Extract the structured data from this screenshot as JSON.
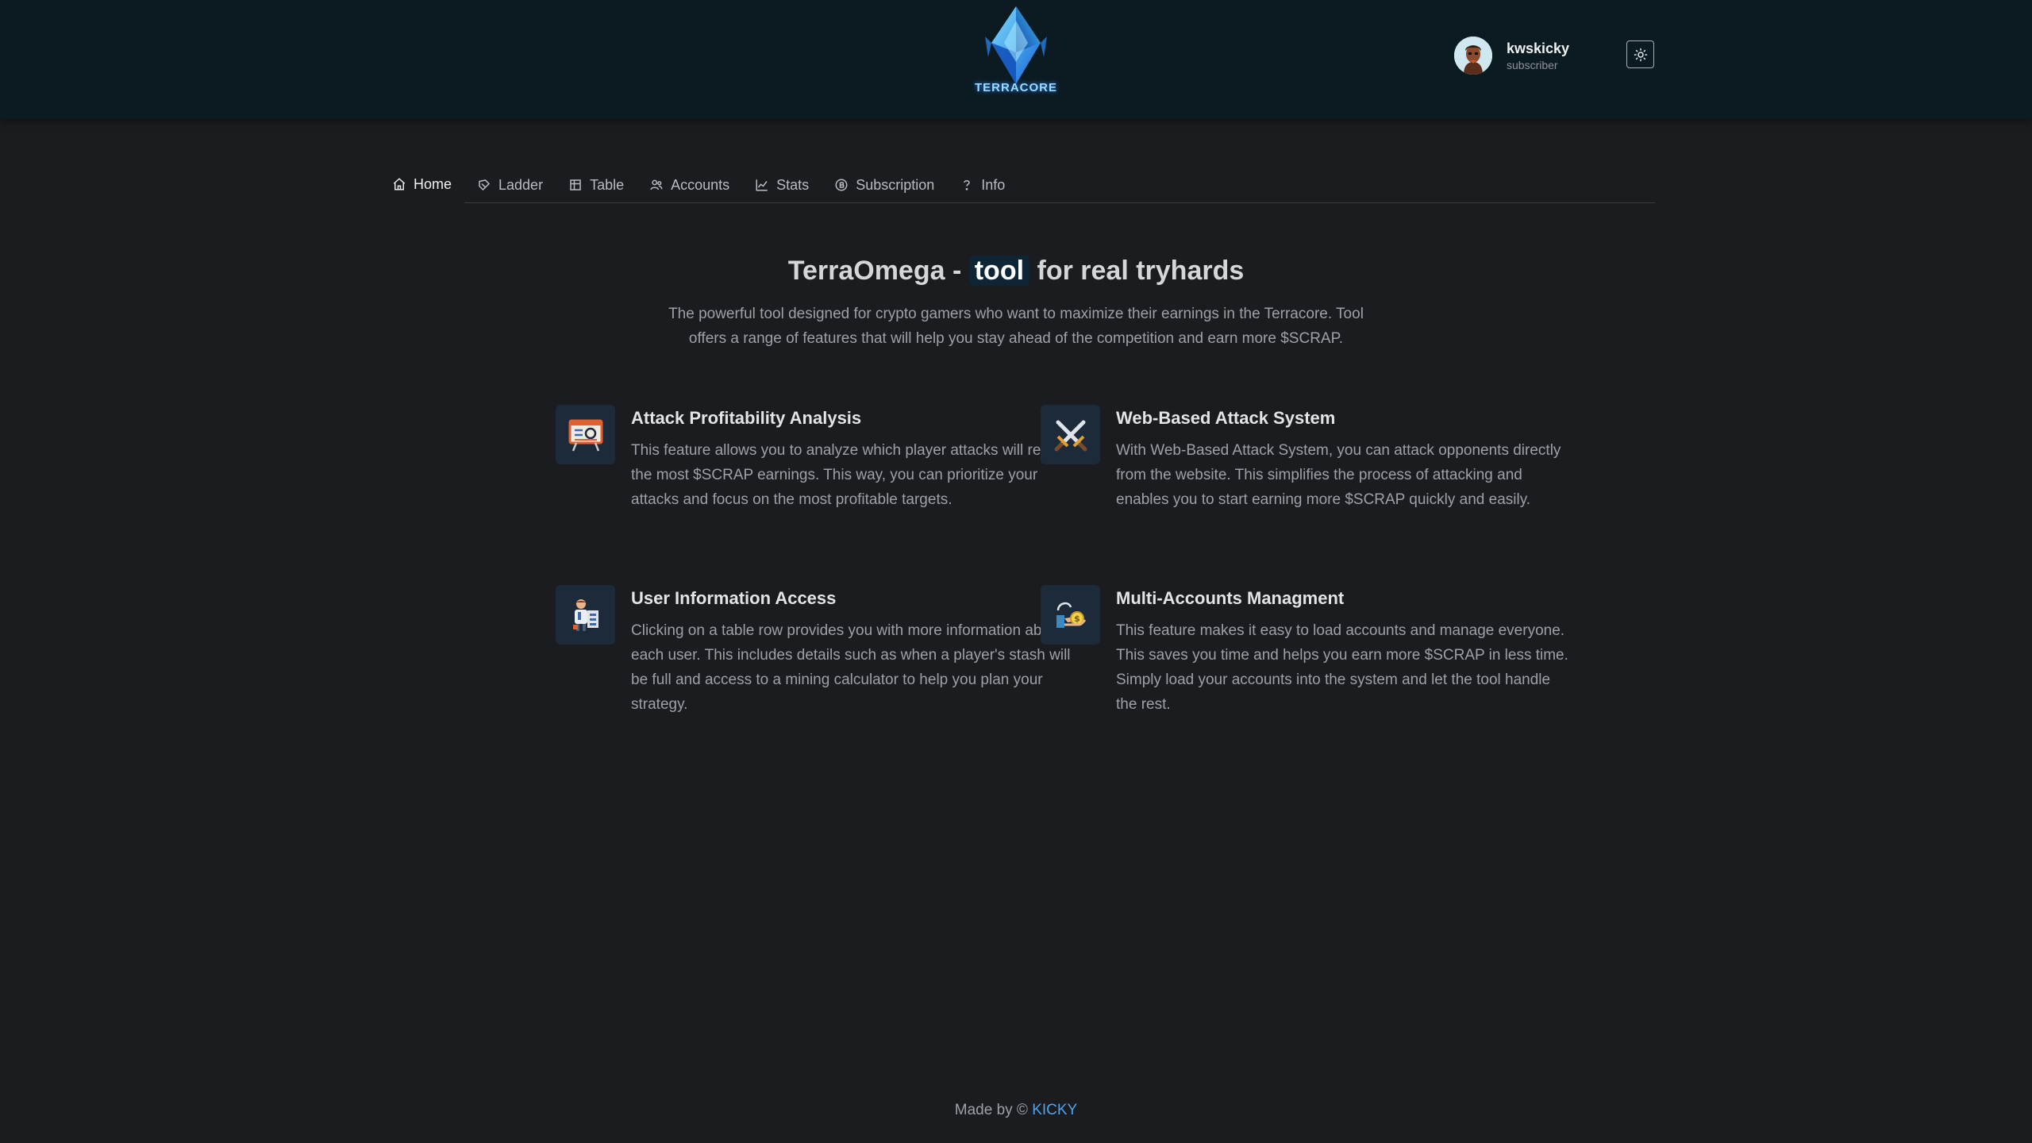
{
  "header": {
    "logo_text": "TERRACORE",
    "user": {
      "name": "kwskicky",
      "role": "subscriber"
    }
  },
  "nav": {
    "tabs": [
      {
        "label": "Home",
        "icon": "home-icon",
        "active": true
      },
      {
        "label": "Ladder",
        "icon": "ladder-icon"
      },
      {
        "label": "Table",
        "icon": "table-icon"
      },
      {
        "label": "Accounts",
        "icon": "accounts-icon"
      },
      {
        "label": "Stats",
        "icon": "stats-icon"
      },
      {
        "label": "Subscription",
        "icon": "coin-icon"
      },
      {
        "label": "Info",
        "icon": "question-icon"
      }
    ]
  },
  "hero": {
    "title_before": "TerraOmega -",
    "title_highlight": "tool",
    "title_after": "for real tryhards",
    "description": "The powerful tool designed for crypto gamers who want to maximize their earnings in the Terracore. Tool offers a range of features that will help you stay ahead of the competition and earn more $SCRAP."
  },
  "features": [
    {
      "title": "Attack Profitability Analysis",
      "description": "This feature allows you to analyze which player attacks will result in the most $SCRAP earnings. This way, you can prioritize your attacks and focus on the most profitable targets.",
      "icon": "analysis-board-icon"
    },
    {
      "title": "Web-Based Attack System",
      "description": "With Web-Based Attack System, you can attack opponents directly from the website. This simplifies the process of attacking and enables you to start earning more $SCRAP quickly and easily.",
      "icon": "crossed-swords-icon"
    },
    {
      "title": "User Information Access",
      "description": "Clicking on a table row provides you with more information about each user. This includes details such as when a player's stash will be full and access to a mining calculator to help you plan your strategy.",
      "icon": "user-info-icon"
    },
    {
      "title": "Multi-Accounts Managment",
      "description": "This feature makes it easy to load accounts and manage everyone. This saves you time and helps you earn more $SCRAP in less time. Simply load your accounts into the system and let the tool handle the rest.",
      "icon": "money-hand-icon"
    }
  ],
  "footer": {
    "prefix": "Made by ©",
    "author": "KICKY"
  },
  "colors": {
    "background": "#1b1c1f",
    "header": "#0c1b22",
    "link": "#4fa3e8",
    "icon_tile": "#1d2a3a"
  }
}
